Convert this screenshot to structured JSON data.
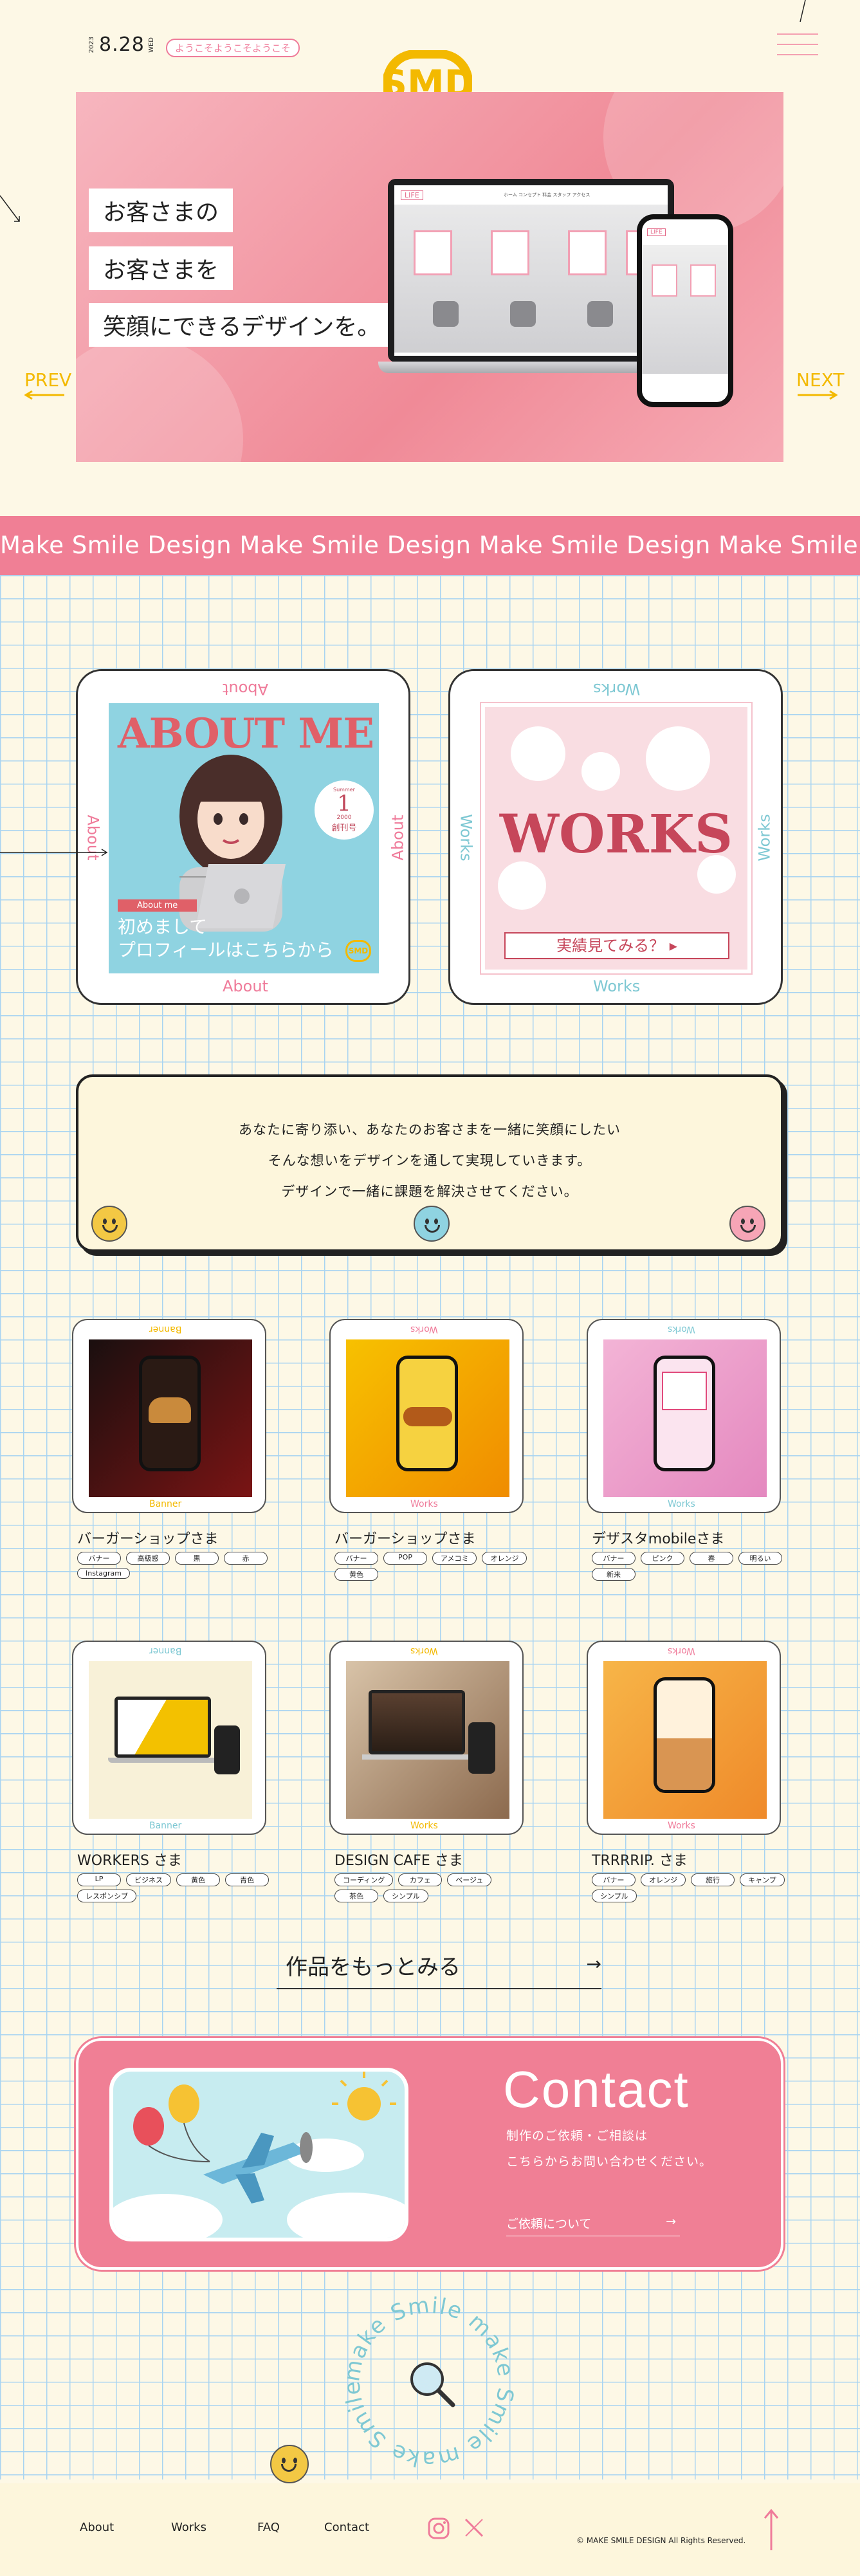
{
  "header": {
    "year": "2023",
    "month_day": "8.28",
    "weekday": "WED",
    "welcome": "ようこそようこそようこそ",
    "logo_text": "SMD"
  },
  "hero": {
    "lines": [
      "お客さまの",
      "お客さまを",
      "笑顔にできるデザインを。"
    ],
    "prev": "PREV",
    "next": "NEXT",
    "site_brand": "LIFE",
    "site_nav": "ホーム  コンセプト  料金  スタッフ  アクセス"
  },
  "marquee": "Make Smile Design Make Smile Design Make Smile Design Make Smile Design Make Smile Design Make S",
  "about_card": {
    "side": "About",
    "mag_title": "ABOUT ME",
    "issue_top": "Summer",
    "issue_num": "1",
    "issue_year": "2000",
    "issue_label": "創刊号",
    "ribbon": "About me",
    "line1": "初めまして",
    "line2": "プロフィールはこちらから"
  },
  "works_card": {
    "side": "Works",
    "title": "WORKS",
    "cta": "実績見てみる？"
  },
  "message": [
    "あなたに寄り添い、あなたのお客さまを一緒に笑顔にしたい",
    "そんな想いをデザインを通して実現していきます。",
    "デザインで一緒に課題を解決させてください。"
  ],
  "works": [
    {
      "label": "Banner",
      "title": "バーガーショップさま",
      "tags": [
        "バナー",
        "高級感",
        "黒",
        "赤",
        "Instagram"
      ]
    },
    {
      "label": "Works",
      "title": "バーガーショップさま",
      "tags": [
        "バナー",
        "POP",
        "アメコミ",
        "オレンジ",
        "黄色"
      ]
    },
    {
      "label": "Works",
      "title": "デザスタmobileさま",
      "tags": [
        "バナー",
        "ピンク",
        "春",
        "明るい",
        "新来"
      ]
    },
    {
      "label": "Banner",
      "title": "WORKERS さま",
      "tags": [
        "LP",
        "ビジネス",
        "黄色",
        "青色",
        "レスポンシブ"
      ]
    },
    {
      "label": "Works",
      "title": "DESIGN CAFE さま",
      "tags": [
        "コーディング",
        "カフェ",
        "ベージュ",
        "茶色",
        "シンプル"
      ]
    },
    {
      "label": "Works",
      "title": "TRRRRIP. さま",
      "tags": [
        "バナー",
        "オレンジ",
        "旅行",
        "キャンプ",
        "シンプル"
      ]
    }
  ],
  "more_works": "作品をもっとみる",
  "more_arrow": "→",
  "contact": {
    "title": "Contact",
    "text1": "制作のご依頼・ご相談は",
    "text2": "こちらからお問い合わせください。",
    "link": "ご依頼について",
    "arrow": "→"
  },
  "badge_text": "make Smile make Smile make Smile",
  "footer": {
    "links": [
      "About",
      "Works",
      "FAQ",
      "Contact"
    ],
    "copyright": "© MAKE SMILE DESIGN All Rights Reserved."
  },
  "colors": {
    "pink": "#f07f95",
    "yellow": "#f3b900",
    "cyan": "#7ec8d3",
    "cream": "#fdf8e6"
  }
}
